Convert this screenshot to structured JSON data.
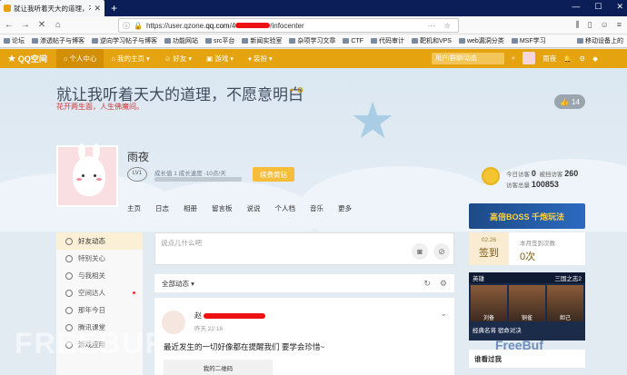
{
  "browser": {
    "tab_title": "就让我听着天大的道理，不愿",
    "url_prefix": "https://user.qzone.",
    "url_domain": "qq.com",
    "url_suffix": "/infocenter"
  },
  "bookmarks": [
    "论坛",
    "渗透帖子与博客",
    "逆向学习帖子与博客",
    "功能网站",
    "src平台",
    "新闻实验室",
    "杂项学习文章",
    "CTF",
    "代码审计",
    "靶机和VPS",
    "web漏洞分类",
    "MSF学习"
  ],
  "bookmarks_right": "移动设备上的",
  "qzone_nav": {
    "logo": "QQ空间",
    "items": [
      "个人中心",
      "我的主页",
      "好友",
      "游戏",
      "装扮"
    ],
    "search_placeholder": "用户/群聊/动态",
    "username": "雨夜"
  },
  "banner": {
    "title": "就让我听着天大的道理，不愿意明白",
    "subtitle": "花开两生面，人生佛魔间。",
    "likes": "14"
  },
  "profile": {
    "name": "雨夜",
    "level": "LV1",
    "growth": "成长值 1   成长速度 -10点/天",
    "renew_button": "续费黄钻"
  },
  "visits": {
    "today_label": "今日访客",
    "today": "0",
    "visited_label": "被挡访客",
    "visited": "260",
    "total_label": "访客总量",
    "total": "100853"
  },
  "subnav": [
    "主页",
    "日志",
    "相册",
    "留言板",
    "说说",
    "个人档",
    "音乐",
    "更多"
  ],
  "leftnav": [
    "好友动态",
    "特别关心",
    "与我相关",
    "空间达人",
    "那年今日",
    "腾讯课堂",
    "游戏应用"
  ],
  "composer": {
    "placeholder": "说点儿什么吧"
  },
  "feed": {
    "filter": "全部动态"
  },
  "post": {
    "author_prefix": "赵",
    "time": "昨天 22:16",
    "text": "最近发生的一切好像都在提醒我们 要学会珍惜~",
    "image_caption": "我的二维码"
  },
  "checkin": {
    "date": "02.26",
    "label": "签到",
    "count_label": "本月签到次数",
    "count": "0次"
  },
  "ad": {
    "text": "高倍BOSS 千炮玩法"
  },
  "game": {
    "header_left": "英雄",
    "header_right": "三国之志2",
    "heroes": [
      "刘备",
      "铜雀",
      "妲己"
    ],
    "footer": "经典名将 宿命对决"
  },
  "side_title": "谁看过我",
  "watermarks": {
    "left": "FREEBUF",
    "right": "FreeBuf"
  }
}
